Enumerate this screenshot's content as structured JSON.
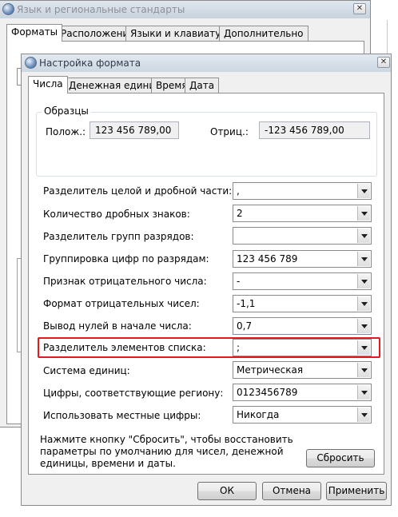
{
  "background_window": {
    "title": "Язык и региональные стандарты",
    "tabs": [
      "Форматы",
      "Расположение",
      "Языки и клавиатуры",
      "Дополнительно"
    ],
    "selected_tab": 0
  },
  "dialog": {
    "title": "Настройка формата",
    "tabs": [
      "Числа",
      "Денежная единица",
      "Время",
      "Дата"
    ],
    "selected_tab": 0,
    "samples": {
      "group_label": "Образцы",
      "positive_label": "Полож.:",
      "positive_value": "123 456 789,00",
      "negative_label": "Отриц.:",
      "negative_value": "-123 456 789,00"
    },
    "settings": [
      {
        "label": "Разделитель целой и дробной части:",
        "value": ","
      },
      {
        "label": "Количество дробных знаков:",
        "value": "2"
      },
      {
        "label": "Разделитель групп разрядов:",
        "value": ""
      },
      {
        "label": "Группировка цифр по разрядам:",
        "value": "123 456 789"
      },
      {
        "label": "Признак отрицательного числа:",
        "value": "-"
      },
      {
        "label": "Формат отрицательных чисел:",
        "value": "-1,1"
      },
      {
        "label": "Вывод нулей в начале числа:",
        "value": "0,7"
      },
      {
        "label": "Разделитель элементов списка:",
        "value": ";"
      },
      {
        "label": "Система единиц:",
        "value": "Метрическая"
      },
      {
        "label": "Цифры, соответствующие региону:",
        "value": "0123456789"
      },
      {
        "label": "Использовать местные цифры:",
        "value": "Никогда"
      }
    ],
    "reset_note": "Нажмите кнопку \"Сбросить\", чтобы восстановить параметры по умолчанию для чисел, денежной единицы, времени и даты.",
    "reset_button": "Сбросить",
    "ok_button": "ОК",
    "cancel_button": "Отмена",
    "apply_button": "Применить"
  },
  "colors": {
    "highlight": "#e01b1b",
    "window_bg": "#f0f0f0"
  }
}
